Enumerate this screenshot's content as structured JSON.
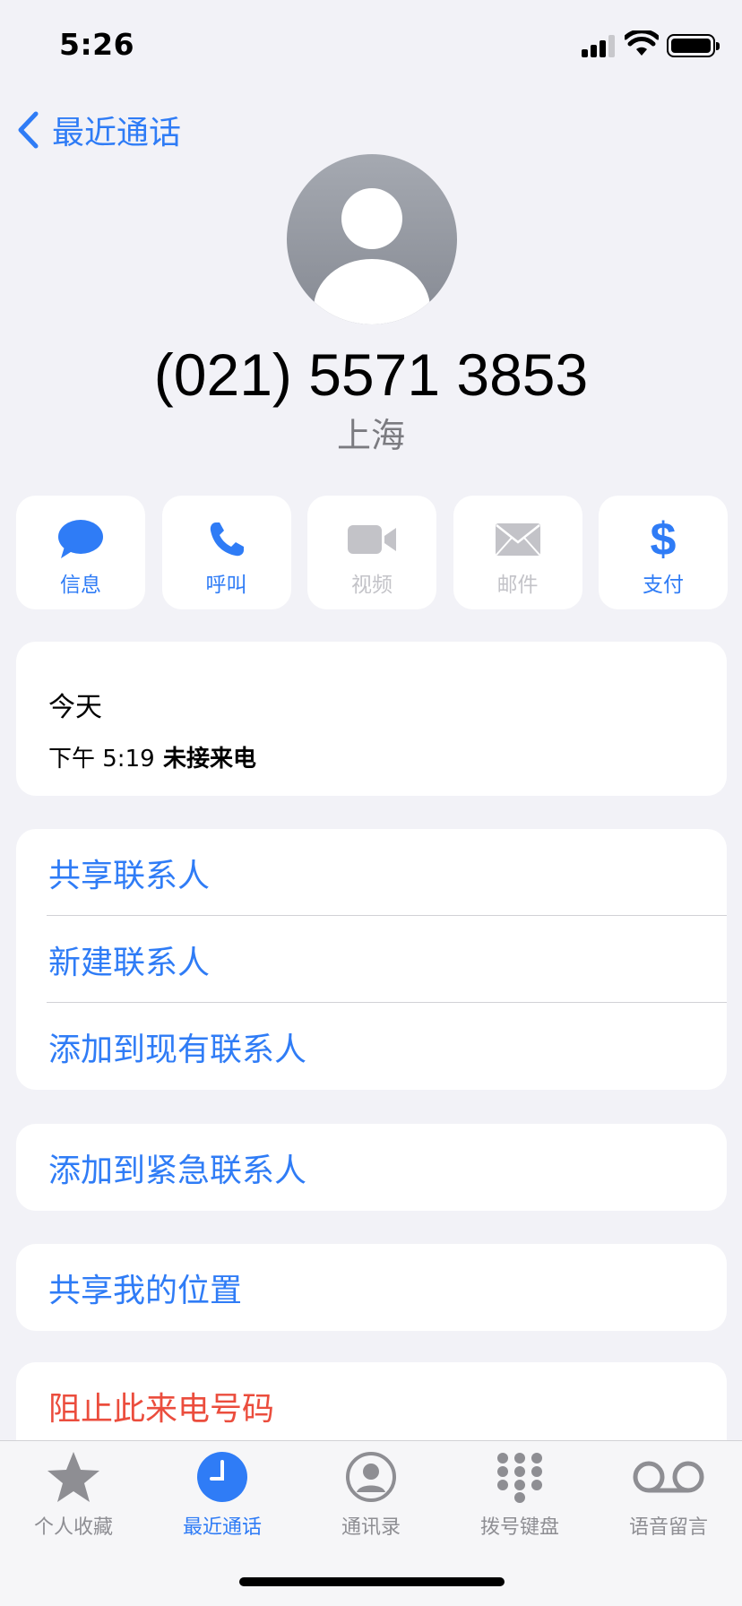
{
  "status_bar": {
    "time": "5:26"
  },
  "nav": {
    "back_label": "最近通话"
  },
  "contact": {
    "phone_number": "(021) 5571 3853",
    "location": "上海"
  },
  "actions": [
    {
      "label": "信息",
      "icon": "message-icon",
      "enabled": true
    },
    {
      "label": "呼叫",
      "icon": "phone-icon",
      "enabled": true
    },
    {
      "label": "视频",
      "icon": "video-icon",
      "enabled": false
    },
    {
      "label": "邮件",
      "icon": "mail-icon",
      "enabled": false
    },
    {
      "label": "支付",
      "icon": "dollar-icon",
      "enabled": true
    }
  ],
  "call_log": {
    "day": "今天",
    "time": "下午 5:19",
    "type": "未接来电"
  },
  "menu": {
    "share_contact": "共享联系人",
    "new_contact": "新建联系人",
    "add_existing": "添加到现有联系人",
    "add_emergency": "添加到紧急联系人",
    "share_location": "共享我的位置",
    "block_caller": "阻止此来电号码"
  },
  "tabbar": {
    "favorites": "个人收藏",
    "recents": "最近通话",
    "contacts": "通讯录",
    "keypad": "拨号键盘",
    "voicemail": "语音留言",
    "active": "recents"
  },
  "colors": {
    "accent": "#2f7cf6",
    "destructive": "#eb4d3d",
    "disabled": "#c3c3c8",
    "background": "#f2f2f7"
  }
}
